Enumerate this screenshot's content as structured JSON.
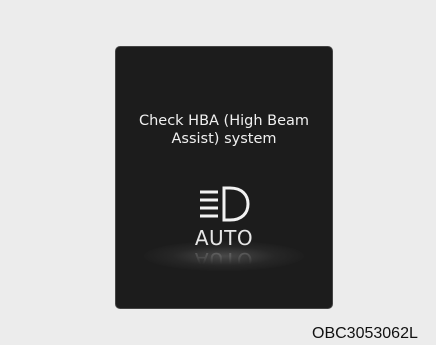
{
  "display": {
    "message_line1": "Check HBA (High Beam",
    "message_line2": "Assist) system",
    "icon": "high-beam-headlamp-icon",
    "auto_label": "AUTO",
    "background_color": "#1c1c1c",
    "text_color": "#f0f0f0"
  },
  "image_code": "OBC3053062L"
}
